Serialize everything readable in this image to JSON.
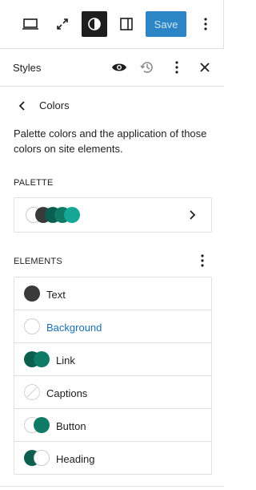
{
  "toolbar": {
    "save_label": "Save",
    "icons": [
      "desktop-icon",
      "fullscreen-icon",
      "styles-icon",
      "sidebar-icon",
      "more-icon"
    ]
  },
  "panel": {
    "title": "Styles",
    "icons": [
      "preview-icon",
      "revisions-icon",
      "more-icon",
      "close-icon"
    ]
  },
  "nav": {
    "title": "Colors"
  },
  "description": "Palette colors and the application of those colors on site elements.",
  "palette": {
    "label": "PALETTE",
    "swatches": [
      "#ffffff",
      "#3a3a3a",
      "#0b5f4f",
      "#0f7a66",
      "#16a797"
    ]
  },
  "elements": {
    "label": "ELEMENTS",
    "items": [
      {
        "label": "Text",
        "highlight": false
      },
      {
        "label": "Background",
        "highlight": true
      },
      {
        "label": "Link",
        "highlight": false
      },
      {
        "label": "Captions",
        "highlight": false
      },
      {
        "label": "Button",
        "highlight": false
      },
      {
        "label": "Heading",
        "highlight": false
      }
    ]
  },
  "colors": {
    "accent": "#2c86c6",
    "link_text": "#1a6fb3",
    "border": "#e0e0e0"
  }
}
